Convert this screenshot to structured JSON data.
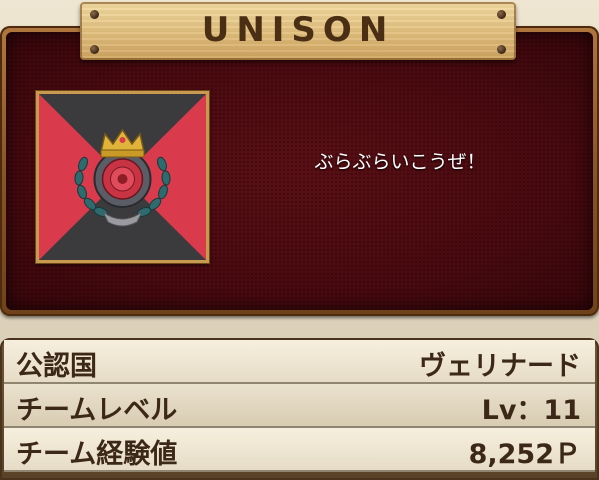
{
  "team": {
    "name": "UNISON",
    "message": "ぶらぶらいこうぜ！",
    "emblem": {
      "icon": "crowned-rose-wreath-emblem",
      "colors": {
        "light": "#d93a4c",
        "dark": "#3b3b3d",
        "frame": "#c79a4f"
      }
    }
  },
  "info": {
    "rows": [
      {
        "label": "公認国",
        "value": "ヴェリナード"
      },
      {
        "label": "チームレベル",
        "value": "Lv：11"
      },
      {
        "label": "チーム経験値",
        "value": "8,252Ｐ"
      }
    ]
  }
}
